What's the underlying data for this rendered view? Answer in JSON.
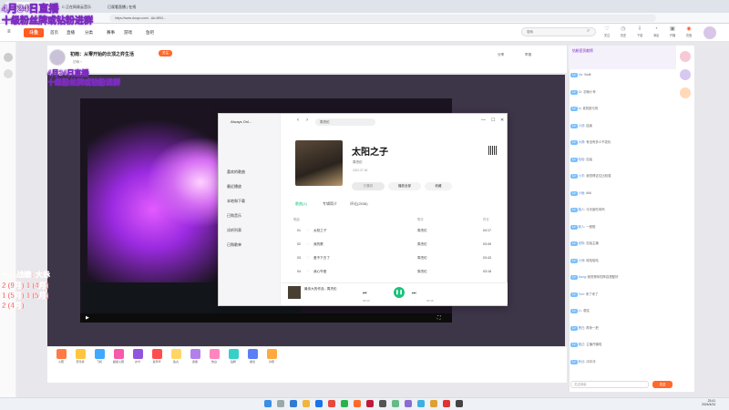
{
  "overlay": {
    "date_line": "4月24日直播",
    "group_line": "十级粉丝牌或钻粉进群",
    "ingame_overlay": "今日战绩: 大赤",
    "record_lines": [
      "2 (9月) 1 (4月)",
      "1 (5月) 1 (5月)",
      "2 (4月)"
    ]
  },
  "browser": {
    "tabs": [
      "_浏览器_直播_",
      "C 正在网易云音乐",
      "已观看直播 | 在线"
    ],
    "url": "https://www.douyu.com/...&k=8f34..."
  },
  "site": {
    "logo": "斗鱼",
    "nav": [
      "首页",
      "直播",
      "分类",
      "赛事",
      "游戏",
      "鱼吧"
    ],
    "search_placeholder": "搜索",
    "top_icons": [
      {
        "label": "关注",
        "icon": "heart-icon"
      },
      {
        "label": "历史",
        "icon": "clock-icon"
      },
      {
        "label": "下载",
        "icon": "download-icon"
      },
      {
        "label": "消息",
        "icon": "bell-icon"
      },
      {
        "label": "开播",
        "icon": "camera-icon"
      },
      {
        "label": "充值",
        "icon": "coin-icon"
      }
    ]
  },
  "room": {
    "title": "初雨：从零开始的云顶之弈生活",
    "streamer": "初雨丶",
    "follow_label": "关注",
    "share_label": "分享",
    "report_label": "举报"
  },
  "music": {
    "header": "Always Onl...",
    "search_text": "周杰伦",
    "sidebar": [
      "喜欢的歌曲",
      "最近播放",
      "本地和下载",
      "已购音乐",
      "试听列表",
      "已购歌单"
    ],
    "song_title": "太阳之子",
    "artist": "周杰伦",
    "date": "2022-07-06",
    "buttons": {
      "liked": "已喜欢",
      "play_all": "播放全部",
      "favorite": "收藏"
    },
    "tabs": [
      "歌曲(1)",
      "专辑简介",
      "评论(2538)"
    ],
    "col_headers": [
      "歌曲",
      "歌手",
      "时长"
    ],
    "tracks": [
      {
        "no": "01",
        "title": "太阳之子",
        "artist": "周杰伦",
        "time": "04:17"
      },
      {
        "no": "02",
        "title": "我的蛋",
        "artist": "周杰伦",
        "time": "03:49"
      },
      {
        "no": "03",
        "title": "爱不下去了",
        "artist": "周杰伦",
        "time": "03:43"
      },
      {
        "no": "04",
        "title": "我心夺爱",
        "artist": "周杰伦",
        "time": "03:18"
      }
    ],
    "now_playing": "最伟大的作品 - 周杰伦",
    "sub_now_playing": "周杰伦",
    "time_start": "00:00",
    "time_end": "03:45"
  },
  "chat": {
    "header": "钻粉团贡献榜",
    "messages": [
      {
        "user": "Vic",
        "text": "Swift"
      },
      {
        "user": "Gr",
        "text": "初雨小号"
      },
      {
        "user": "rs",
        "text": "真的挺亏的"
      },
      {
        "user": "小孩",
        "text": "结束"
      },
      {
        "user": "大胖",
        "text": "有没有多少不变化"
      },
      {
        "user": "哈哈",
        "text": "加油"
      },
      {
        "user": "小羊",
        "text": "我觉得这位比较强"
      },
      {
        "user": "小鱼",
        "text": "666"
      },
      {
        "user": "路人",
        "text": "今天能吃鸡吗"
      },
      {
        "user": "新人",
        "text": "一般般"
      },
      {
        "user": "老粉",
        "text": "加油主播"
      },
      {
        "user": "小熊",
        "text": "哈哈哈哈"
      },
      {
        "user": "Jiang",
        "text": "我觉得你的阵容搭配好"
      },
      {
        "user": "Tom",
        "text": "来了来了"
      },
      {
        "user": "LL",
        "text": "稳住"
      },
      {
        "user": "黑白",
        "text": "再来一把"
      },
      {
        "user": "路过",
        "text": "主播开播啦"
      },
      {
        "user": "粉丝",
        "text": "冲冲冲"
      }
    ],
    "input_placeholder": "发送弹幕",
    "send_label": "发送"
  },
  "gifts": [
    "火箭",
    "荧光棒",
    "飞机",
    "超级火箭",
    "办卡",
    "嘉年华",
    "鱼丸",
    "贵族",
    "告白",
    "钻粉",
    "魔法",
    "许愿"
  ],
  "taskbar": {
    "time": "23:41",
    "date": "2024/4/24"
  }
}
